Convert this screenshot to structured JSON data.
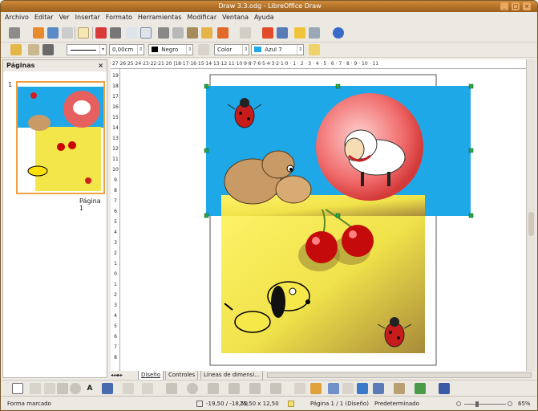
{
  "window": {
    "title": "Draw 3.3.odg - LibreOffice Draw"
  },
  "menu": [
    "Archivo",
    "Editar",
    "Ver",
    "Insertar",
    "Formato",
    "Herramientas",
    "Modificar",
    "Ventana",
    "Ayuda"
  ],
  "line_toolbar": {
    "width_value": "0,00cm",
    "line_color": "Negro",
    "fill_type": "Color",
    "fill_color": "Azul 7"
  },
  "pages_panel": {
    "title": "Páginas",
    "close": "×",
    "page_number": "1",
    "page_label": "Página 1"
  },
  "ruler_h_text": "·27·26·25·24·23·22·21·20 |18·17·16·15·14·13·12·11·10·9·8·7·6·5·4·3·2·1·0 · 1 · 2 · 3 · 4 · 5 · 6 · 7 · 8 · 9 · 10 · 11",
  "ruler_v_labels": [
    "19",
    "18",
    "17",
    "16",
    "15",
    "14",
    "13",
    "12",
    "11",
    "10",
    "9",
    "8",
    "7",
    "6",
    "5",
    "4",
    "3",
    "2",
    "1",
    "0",
    "1",
    "2",
    "3",
    "4",
    "5",
    "6",
    "7",
    "8"
  ],
  "layer_tabs": [
    "Diseño",
    "Controles",
    "Líneas de dimensi..."
  ],
  "status": {
    "mode": "Forma marcado",
    "position": "-19,50 / -18,50",
    "size": "25,50 x 12,50",
    "page": "Página 1 / 1 (Diseño)",
    "style": "Predeterminado",
    "zoom": "65%"
  },
  "colors": {
    "title_bar": "#b8732a",
    "blue_rect": "#1ea8e8",
    "yellow": "#f2e64a"
  }
}
